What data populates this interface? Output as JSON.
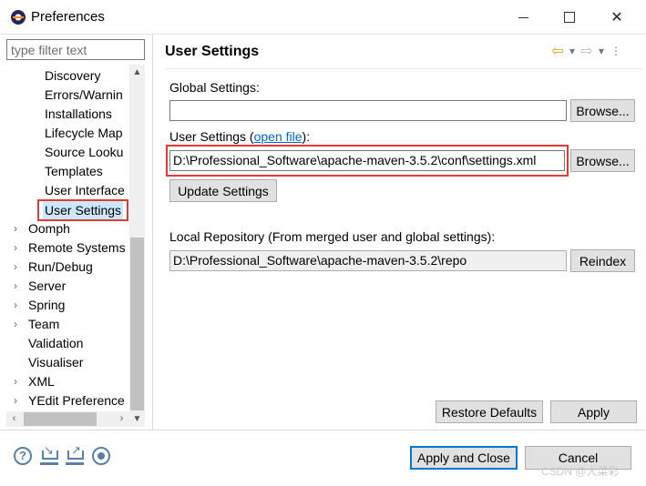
{
  "window": {
    "title": "Preferences"
  },
  "filter": {
    "placeholder": "type filter text"
  },
  "tree": [
    {
      "label": "Discovery",
      "expandable": false
    },
    {
      "label": "Errors/Warnin",
      "expandable": false
    },
    {
      "label": "Installations",
      "expandable": false
    },
    {
      "label": "Lifecycle Map",
      "expandable": false
    },
    {
      "label": "Source Looku",
      "expandable": false
    },
    {
      "label": "Templates",
      "expandable": false
    },
    {
      "label": "User Interface",
      "expandable": false
    },
    {
      "label": "User Settings",
      "expandable": false,
      "selected": true
    },
    {
      "label": "Oomph",
      "expandable": true
    },
    {
      "label": "Remote Systems",
      "expandable": true
    },
    {
      "label": "Run/Debug",
      "expandable": true
    },
    {
      "label": "Server",
      "expandable": true
    },
    {
      "label": "Spring",
      "expandable": true
    },
    {
      "label": "Team",
      "expandable": true
    },
    {
      "label": "Validation",
      "expandable": false
    },
    {
      "label": "Visualiser",
      "expandable": false
    },
    {
      "label": "XML",
      "expandable": true
    },
    {
      "label": "YEdit Preference",
      "expandable": true
    }
  ],
  "page": {
    "title": "User Settings",
    "global_settings_label": "Global Settings:",
    "global_settings_value": "",
    "browse_label": "Browse...",
    "user_settings_label_prefix": "User Settings (",
    "open_file_link": "open file",
    "user_settings_label_suffix": "):",
    "user_settings_value": "D:\\Professional_Software\\apache-maven-3.5.2\\conf\\settings.xml",
    "update_settings_label": "Update Settings",
    "local_repo_label": "Local Repository (From merged user and global settings):",
    "local_repo_value": "D:\\Professional_Software\\apache-maven-3.5.2\\repo",
    "reindex_label": "Reindex",
    "restore_defaults_label": "Restore Defaults",
    "apply_label": "Apply"
  },
  "footer": {
    "apply_close_label": "Apply and Close",
    "cancel_label": "Cancel",
    "watermark": "CSDN @大菜彩"
  },
  "colors": {
    "highlight_border": "#e53935",
    "selection": "#cce8ff",
    "link": "#0066cc",
    "default_button": "#0078d7"
  }
}
